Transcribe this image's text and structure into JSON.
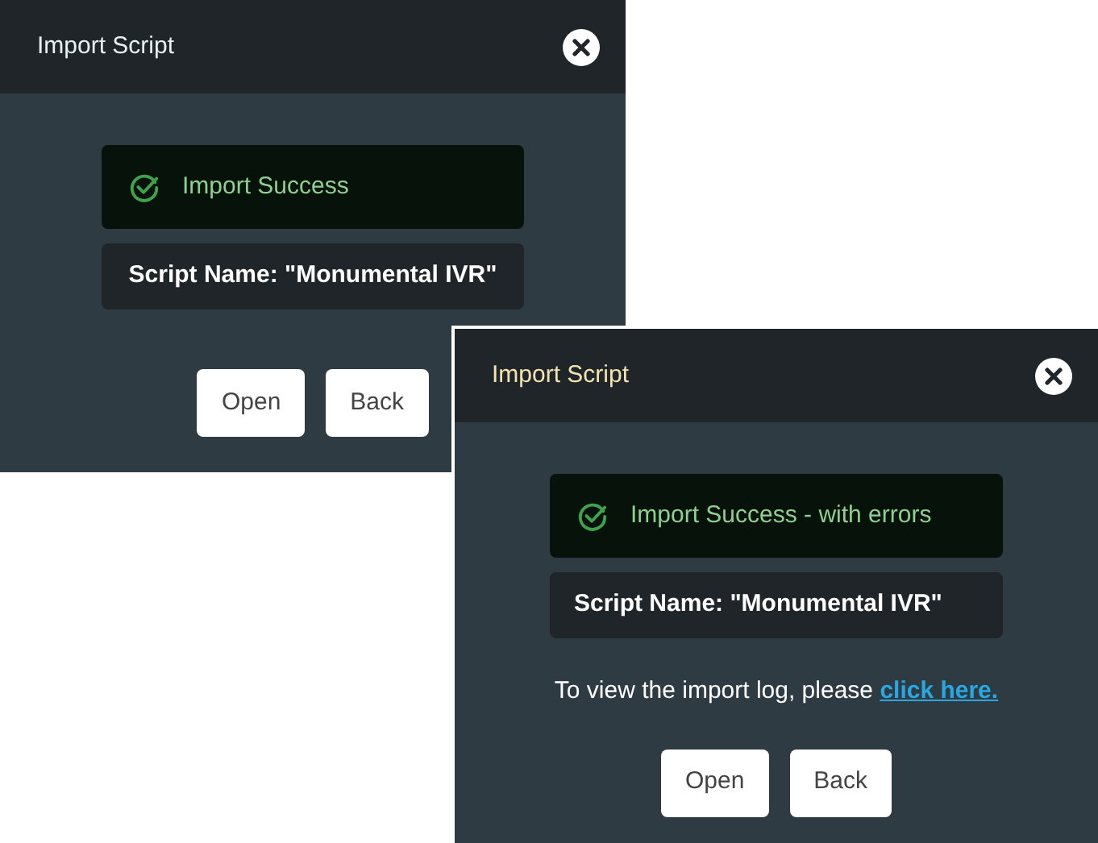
{
  "dialogs": [
    {
      "title": "Import Script",
      "status": "Import Success",
      "script_name": "Script Name: \"Monumental IVR\"",
      "buttons": [
        "Open",
        "Back"
      ]
    },
    {
      "title": "Import Script",
      "status": "Import Success - with errors",
      "script_name": "Script Name: \"Monumental IVR\"",
      "log_text": "To view the import log, please ",
      "log_link": "click here.",
      "buttons": [
        "Open",
        "Back"
      ]
    }
  ]
}
